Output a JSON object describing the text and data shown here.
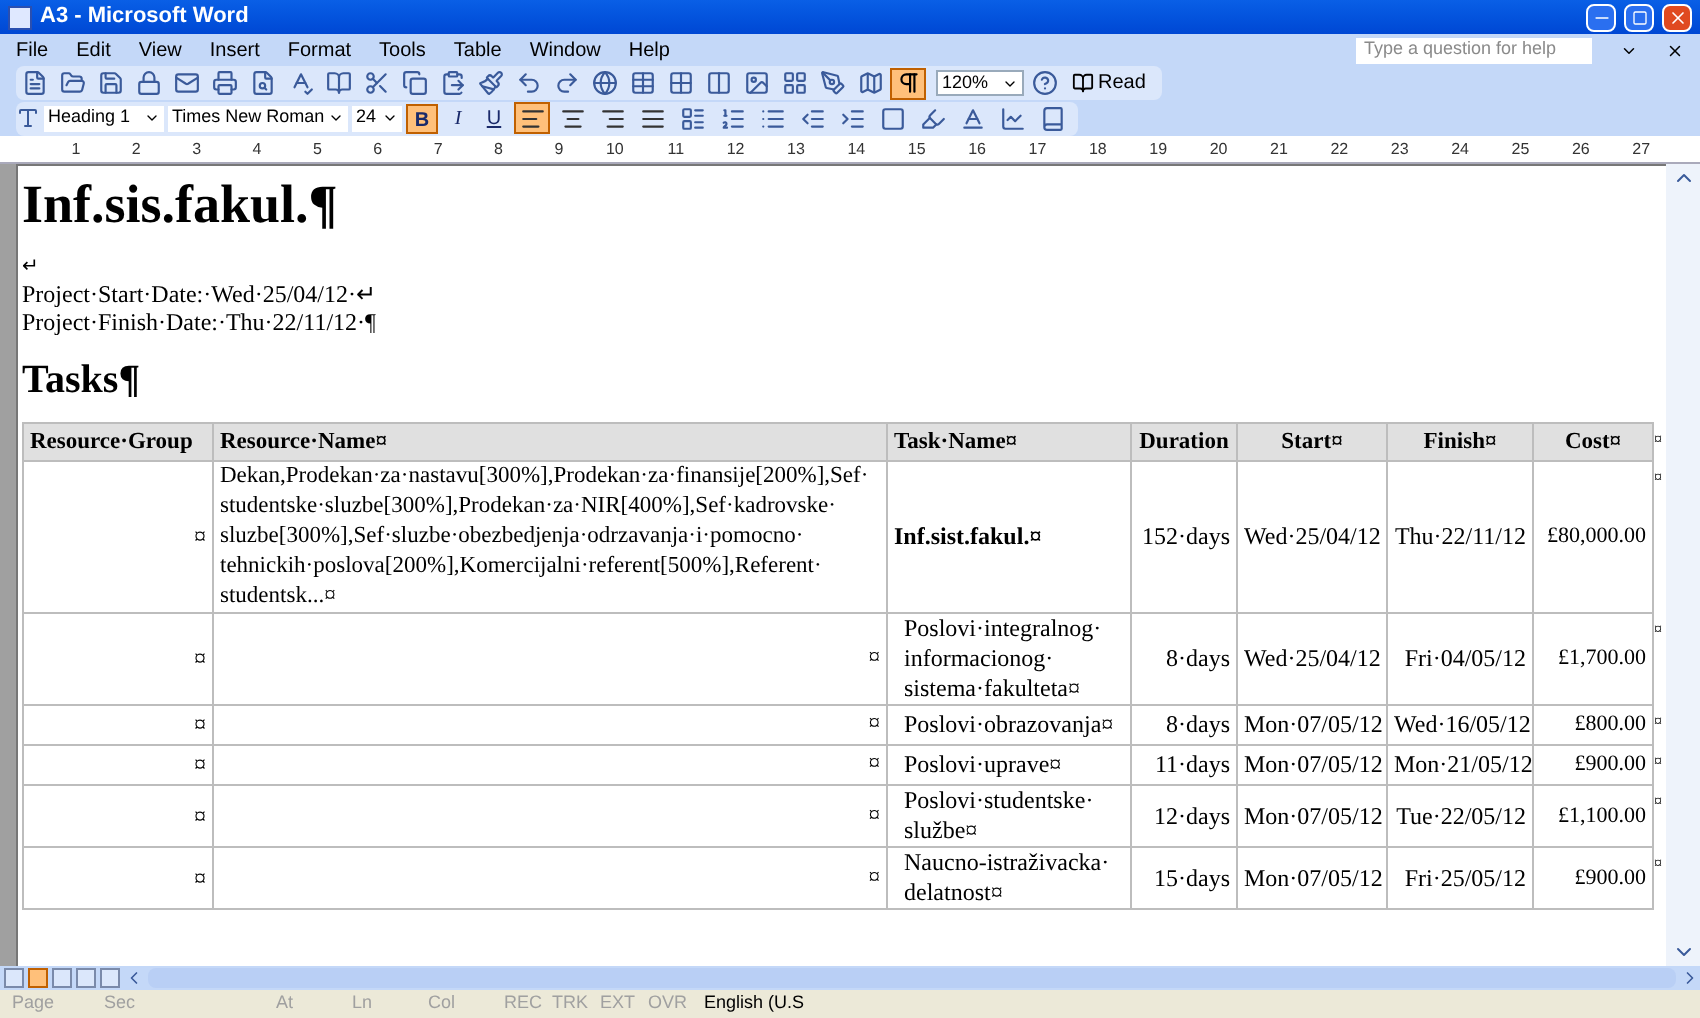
{
  "window": {
    "title": "A3 - Microsoft Word"
  },
  "menu": [
    "File",
    "Edit",
    "View",
    "Insert",
    "Format",
    "Tools",
    "Table",
    "Window",
    "Help"
  ],
  "help_box": {
    "placeholder": "Type a question for help"
  },
  "standard_toolbar": {
    "zoom": "120%",
    "read": "Read",
    "show_marks": true
  },
  "format_toolbar": {
    "style": "Heading 1",
    "font": "Times New Roman",
    "size": "24",
    "buttons": [
      {
        "label": "B",
        "kind": "bold",
        "selected": true
      },
      {
        "label": "I",
        "kind": "italic",
        "selected": false
      },
      {
        "label": "U",
        "kind": "underline",
        "selected": false
      }
    ],
    "align": [
      {
        "kind": "left",
        "selected": true
      },
      {
        "kind": "center",
        "selected": false
      },
      {
        "kind": "right",
        "selected": false
      },
      {
        "kind": "justify",
        "selected": false
      }
    ]
  },
  "ruler": [
    "1",
    "2",
    "3",
    "4",
    "5",
    "6",
    "7",
    "8",
    "9",
    "10",
    "11",
    "12",
    "13",
    "14",
    "15",
    "16",
    "17",
    "18",
    "19",
    "20",
    "21",
    "22",
    "23",
    "24",
    "25",
    "26",
    "27"
  ],
  "document": {
    "title": "Inf.sis.fakul.¶",
    "break": "↵",
    "lines": [
      "Project·Start·Date:·Wed·25/04/12·↵",
      "Project·Finish·Date:·Thu·22/11/12·¶"
    ],
    "section": "Tasks¶"
  },
  "table": {
    "columns": [
      "Resource·Group",
      "Resource·Name¤",
      "Task·Name¤",
      "Duration",
      "Start¤",
      "Finish¤",
      "Cost¤"
    ],
    "header_end": "¤",
    "rows": [
      {
        "group": "¤",
        "resource": "Dekan,Prodekan·za·nastavu[300%],Prodekan·za·finansije[200%],Sef·studentske·sluzbe[300%],Prodekan·za·NIR[400%],Sef·kadrovske·sluzbe[300%],Sef·sluzbe·obezbedjenja·odrzavanja·i·pomocno·tehnickih·poslova[200%],Komercijalni·referent[500%],Referent·studentsk...¤",
        "task": "Inf.sist.fakul.¤",
        "summary": true,
        "duration": "152·days",
        "start": "Wed·25/04/12",
        "finish": "Thu·22/11/12",
        "cost": "£80,000.00",
        "end": "¤"
      },
      {
        "group": "¤",
        "resource": "¤",
        "task": "Poslovi·integralnog·informacionog·sistema·fakulteta¤",
        "summary": false,
        "duration": "8·days",
        "start": "Wed·25/04/12",
        "finish": "Fri·04/05/12",
        "cost": "£1,700.00",
        "end": "¤"
      },
      {
        "group": "¤",
        "resource": "¤",
        "task": "Poslovi·obrazovanja¤",
        "summary": false,
        "duration": "8·days",
        "start": "Mon·07/05/12",
        "finish": "Wed·16/05/12",
        "cost": "£800.00",
        "end": "¤"
      },
      {
        "group": "¤",
        "resource": "¤",
        "task": "Poslovi·uprave¤",
        "summary": false,
        "duration": "11·days",
        "start": "Mon·07/05/12",
        "finish": "Mon·21/05/12",
        "cost": "£900.00",
        "end": "¤"
      },
      {
        "group": "¤",
        "resource": "¤",
        "task": "Poslovi·studentske·službe¤",
        "summary": false,
        "duration": "12·days",
        "start": "Mon·07/05/12",
        "finish": "Tue·22/05/12",
        "cost": "£1,100.00",
        "end": "¤"
      },
      {
        "group": "¤",
        "resource": "¤",
        "task": "Naucno-istraživacka·delatnost¤",
        "summary": false,
        "duration": "15·days",
        "start": "Mon·07/05/12",
        "finish": "Fri·25/05/12",
        "cost": "£900.00",
        "end": "¤"
      }
    ]
  },
  "view_buttons": [
    {
      "selected": false
    },
    {
      "selected": true
    },
    {
      "selected": false
    },
    {
      "selected": false
    },
    {
      "selected": false
    }
  ],
  "status_bar": [
    {
      "label": "Page",
      "disabled": true
    },
    {
      "label": "Sec",
      "disabled": true
    },
    {
      "label": "At",
      "disabled": true
    },
    {
      "label": "Ln",
      "disabled": true
    },
    {
      "label": "Col",
      "disabled": true
    },
    {
      "label": "REC",
      "disabled": true
    },
    {
      "label": "TRK",
      "disabled": true
    },
    {
      "label": "EXT",
      "disabled": true
    },
    {
      "label": "OVR",
      "disabled": true
    },
    {
      "label": "English (U.S",
      "disabled": false
    }
  ]
}
